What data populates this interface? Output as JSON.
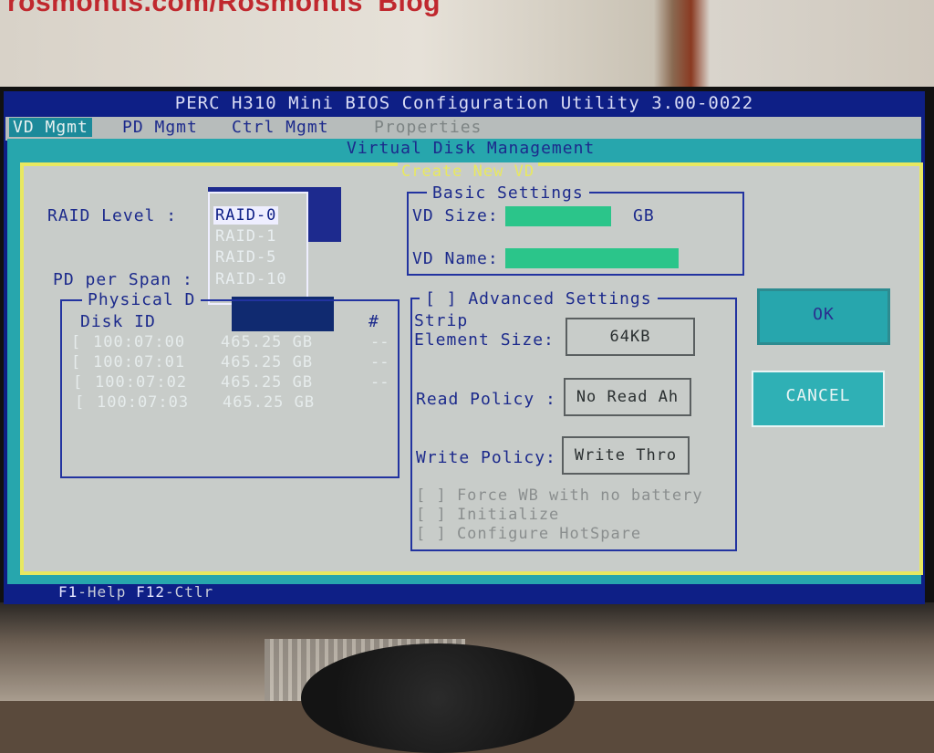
{
  "watermark": "rosmontis.com/Rosmontis' Blog",
  "app": {
    "title": "PERC H310 Mini BIOS Configuration Utility 3.00-0022"
  },
  "menu": [
    {
      "label": "VD Mgmt",
      "active": true
    },
    {
      "label": "PD Mgmt",
      "active": false
    },
    {
      "label": "Ctrl Mgmt",
      "active": false
    },
    {
      "label": "Properties",
      "active": false
    }
  ],
  "panel": {
    "title": "Virtual Disk Management"
  },
  "dialog": {
    "title": "Create New VD",
    "raid_level_label": "RAID Level :",
    "raid_options": [
      "RAID-0",
      "RAID-1",
      "RAID-5",
      "RAID-10"
    ],
    "raid_selected": "RAID-0",
    "pd_per_span_label": "PD per Span :",
    "physical_disks": {
      "title": "Physical D",
      "col_id": "Disk ID",
      "col_hash": "#",
      "rows": [
        {
          "check": "[",
          "id": "100:07:00",
          "size": "465.25 GB",
          "num": "--"
        },
        {
          "check": "[",
          "id": "100:07:01",
          "size": "465.25 GB",
          "num": "--"
        },
        {
          "check": "[",
          "id": "100:07:02",
          "size": "465.25 GB",
          "num": "--"
        },
        {
          "check": "[",
          "id": "100:07:03",
          "size": "465.25 GB",
          "num": "--"
        }
      ]
    },
    "basic": {
      "title": "Basic Settings",
      "vd_size_label": "VD Size:",
      "vd_size_unit": "GB",
      "vd_name_label": "VD Name:"
    },
    "advanced": {
      "title": "[ ] Advanced Settings",
      "strip_label_1": "Strip",
      "strip_label_2": "Element Size:",
      "strip_value": "64KB",
      "read_label": "Read Policy :",
      "read_value": "No Read Ah",
      "write_label": "Write Policy:",
      "write_value": "Write Thro",
      "checks": [
        "[ ] Force WB with no battery",
        "[ ] Initialize",
        "[ ] Configure HotSpare"
      ]
    },
    "ok_label": "OK",
    "cancel_label": "CANCEL"
  },
  "status": {
    "f1": "F1",
    "f1_text": "-Help ",
    "f12": "F12",
    "f12_text": "-Ctlr"
  },
  "colors": {
    "bios_blue": "#0e1f86",
    "teal": "#27a6ad",
    "grey": "#c8ccc9",
    "yellow": "#e8e860",
    "green": "#2bc58a"
  }
}
